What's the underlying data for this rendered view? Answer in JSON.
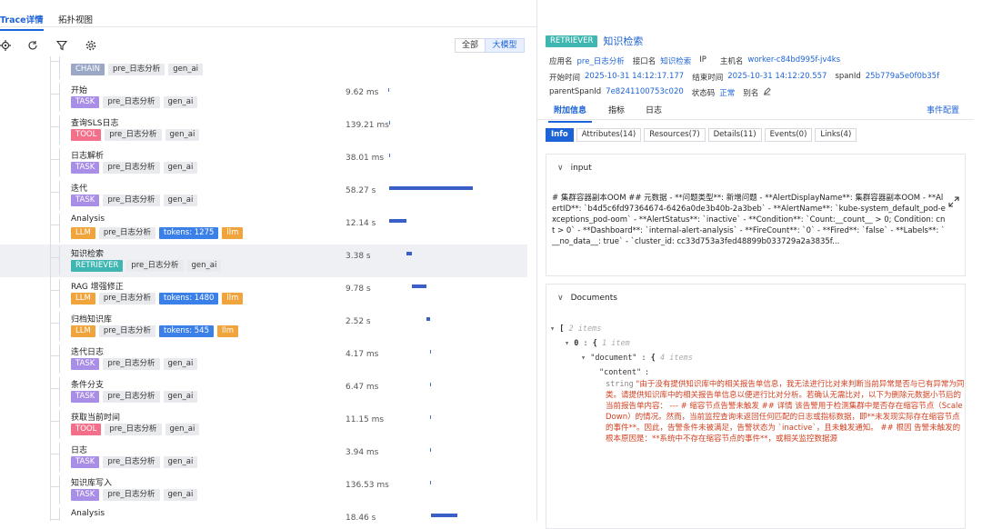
{
  "tabs": [
    "Trace详情",
    "拓扑视图"
  ],
  "modes": [
    "全部",
    "大模型"
  ],
  "spans": [
    {
      "name": "",
      "kind": "CHAIN",
      "kind_class": "b-chain",
      "tags": [
        "pre_日志分析",
        "gen_ai"
      ],
      "duration": "",
      "bar_start": 0,
      "bar_end": 0
    },
    {
      "name": "开始",
      "kind": "TASK",
      "kind_class": "b-task",
      "tags": [
        "pre_日志分析",
        "gen_ai"
      ],
      "duration": "9.62 ms",
      "bar_start": 0.0,
      "bar_end": 0.0
    },
    {
      "name": "查询SLS日志",
      "kind": "TOOL",
      "kind_class": "b-tool",
      "tags": [
        "pre_日志分析",
        "gen_ai"
      ],
      "duration": "139.21 ms",
      "bar_start": 0.005,
      "bar_end": 0.006
    },
    {
      "name": "日志解析",
      "kind": "TASK",
      "kind_class": "b-task",
      "tags": [
        "pre_日志分析",
        "gen_ai"
      ],
      "duration": "38.01 ms",
      "bar_start": 0.006,
      "bar_end": 0.007
    },
    {
      "name": "迭代",
      "kind": "TASK",
      "kind_class": "b-task",
      "tags": [
        "pre_日志分析",
        "gen_ai"
      ],
      "duration": "58.27 s",
      "bar_start": 0.007,
      "bar_end": 0.61
    },
    {
      "name": "Analysis",
      "kind": "LLM",
      "kind_class": "b-llm",
      "tags": [
        "pre_日志分析"
      ],
      "tokens": "tokens: 1275",
      "tail": "llm",
      "duration": "12.14 s",
      "bar_start": 0.007,
      "bar_end": 0.133
    },
    {
      "name": "知识检索",
      "kind": "RETRIEVER",
      "kind_class": "b-ret",
      "tags": [
        "pre_日志分析",
        "gen_ai"
      ],
      "duration": "3.38 s",
      "bar_start": 0.133,
      "bar_end": 0.168,
      "selected": true
    },
    {
      "name": "RAG 增强修正",
      "kind": "LLM",
      "kind_class": "b-llm",
      "tags": [
        "pre_日志分析"
      ],
      "tokens": "tokens: 1480",
      "tail": "llm",
      "duration": "9.78 s",
      "bar_start": 0.17,
      "bar_end": 0.272
    },
    {
      "name": "归档知识库",
      "kind": "LLM",
      "kind_class": "b-llm",
      "tags": [
        "pre_日志分析"
      ],
      "tokens": "tokens: 545",
      "tail": "llm",
      "duration": "2.52 s",
      "bar_start": 0.272,
      "bar_end": 0.298
    },
    {
      "name": "迭代日志",
      "kind": "TASK",
      "kind_class": "b-task",
      "tags": [
        "pre_日志分析",
        "gen_ai"
      ],
      "duration": "4.17 ms",
      "bar_start": 0.299,
      "bar_end": 0.3
    },
    {
      "name": "条件分支",
      "kind": "TASK",
      "kind_class": "b-task",
      "tags": [
        "pre_日志分析",
        "gen_ai"
      ],
      "duration": "6.47 ms",
      "bar_start": 0.3,
      "bar_end": 0.301
    },
    {
      "name": "获取当前时间",
      "kind": "TOOL",
      "kind_class": "b-tool",
      "tags": [
        "pre_日志分析",
        "gen_ai"
      ],
      "duration": "11.15 ms",
      "bar_start": 0.301,
      "bar_end": 0.302
    },
    {
      "name": "日志",
      "kind": "TASK",
      "kind_class": "b-task",
      "tags": [
        "pre_日志分析",
        "gen_ai"
      ],
      "duration": "3.94 ms",
      "bar_start": 0.302,
      "bar_end": 0.303
    },
    {
      "name": "知识库写入",
      "kind": "TASK",
      "kind_class": "b-task",
      "tags": [
        "pre_日志分析",
        "gen_ai"
      ],
      "duration": "136.53 ms",
      "bar_start": 0.303,
      "bar_end": 0.305
    },
    {
      "name": "Analysis",
      "kind": "LLM",
      "kind_class": "b-llm",
      "tags": [
        "pre_日志分析"
      ],
      "tokens": "",
      "tail": "",
      "duration": "18.46 s",
      "bar_start": 0.305,
      "bar_end": 0.5
    }
  ],
  "detail": {
    "kind": "RETRIEVER",
    "name": "知识检索",
    "labels": {
      "app": "应用名",
      "api": "接口名",
      "ip": "IP",
      "host": "主机名",
      "start": "开始时间",
      "end": "结束时间",
      "span": "spanId",
      "parent": "parentSpanId",
      "status": "状态码",
      "alias": "别名"
    },
    "app": "pre_日志分析",
    "api": "知识检索",
    "host": "worker-c84bd995f-jv4ks",
    "start": "2025-10-31 14:12:17.177",
    "end": "2025-10-31 14:12:20.557",
    "span": "25b779a5e0f0b35f",
    "parent": "7e8241100753c020",
    "status": "正常",
    "tabs": [
      "附加信息",
      "指标",
      "日志"
    ],
    "event_config": "事件配置",
    "subtabs": [
      "Info",
      "Attributes(14)",
      "Resources(7)",
      "Details(11)",
      "Events(0)",
      "Links(4)"
    ],
    "input_title": "input",
    "input_text": "# 集群容器副本OOM ## 元数据 - **问题类型**: 新增问题 - **AlertDisplayName**: 集群容器副本OOM - **AlertID**: `b4d5c6fd97364674-6426a0de3b40b-2a3beb` - **AlertName**: `kube-system_default_pod-exceptions_pod-oom` - **AlertStatus**: `inactive` - **Condition**: `Count:__count__ > 0; Condition: cnt > 0` - **Dashboard**: `internal-alert-analysis` - **FireCount**: `0` - **Fired**: `false` - **Labels**: `__no_data__: true` - `cluster_id: cc33d753a3fed48899b033729a2a3835f...",
    "docs_title": "Documents",
    "j_items2": "2 items",
    "j_item1": "1 item",
    "j_items4": "4 items",
    "j_doc": "\"document\"",
    "j_content": "\"content\"",
    "j_string": "string",
    "content_text": "\"由于没有提供知识库中的相关报告单信息，我无法进行比对来判断当前异常是否与已有异常为同类。请提供知识库中的相关报告单信息以便进行比对分析。若确认无需比对，以下为删除元数据小节后的当前报告单内容： --- # 缩容节点告警未触发 ## 详情 该告警用于检测集群中是否存在缩容节点（ScaleDown）的情况。然而，当前监控查询未返回任何匹配的日志或指标数据，即**未发现实际存在缩容节点的事件**。因此，告警条件未被满足，告警状态为 `inactive`，且未触发通知。 ## 根因 告警未触发的根本原因是：**系统中不存在缩容节点的事件**，或相关监控数据源"
  }
}
